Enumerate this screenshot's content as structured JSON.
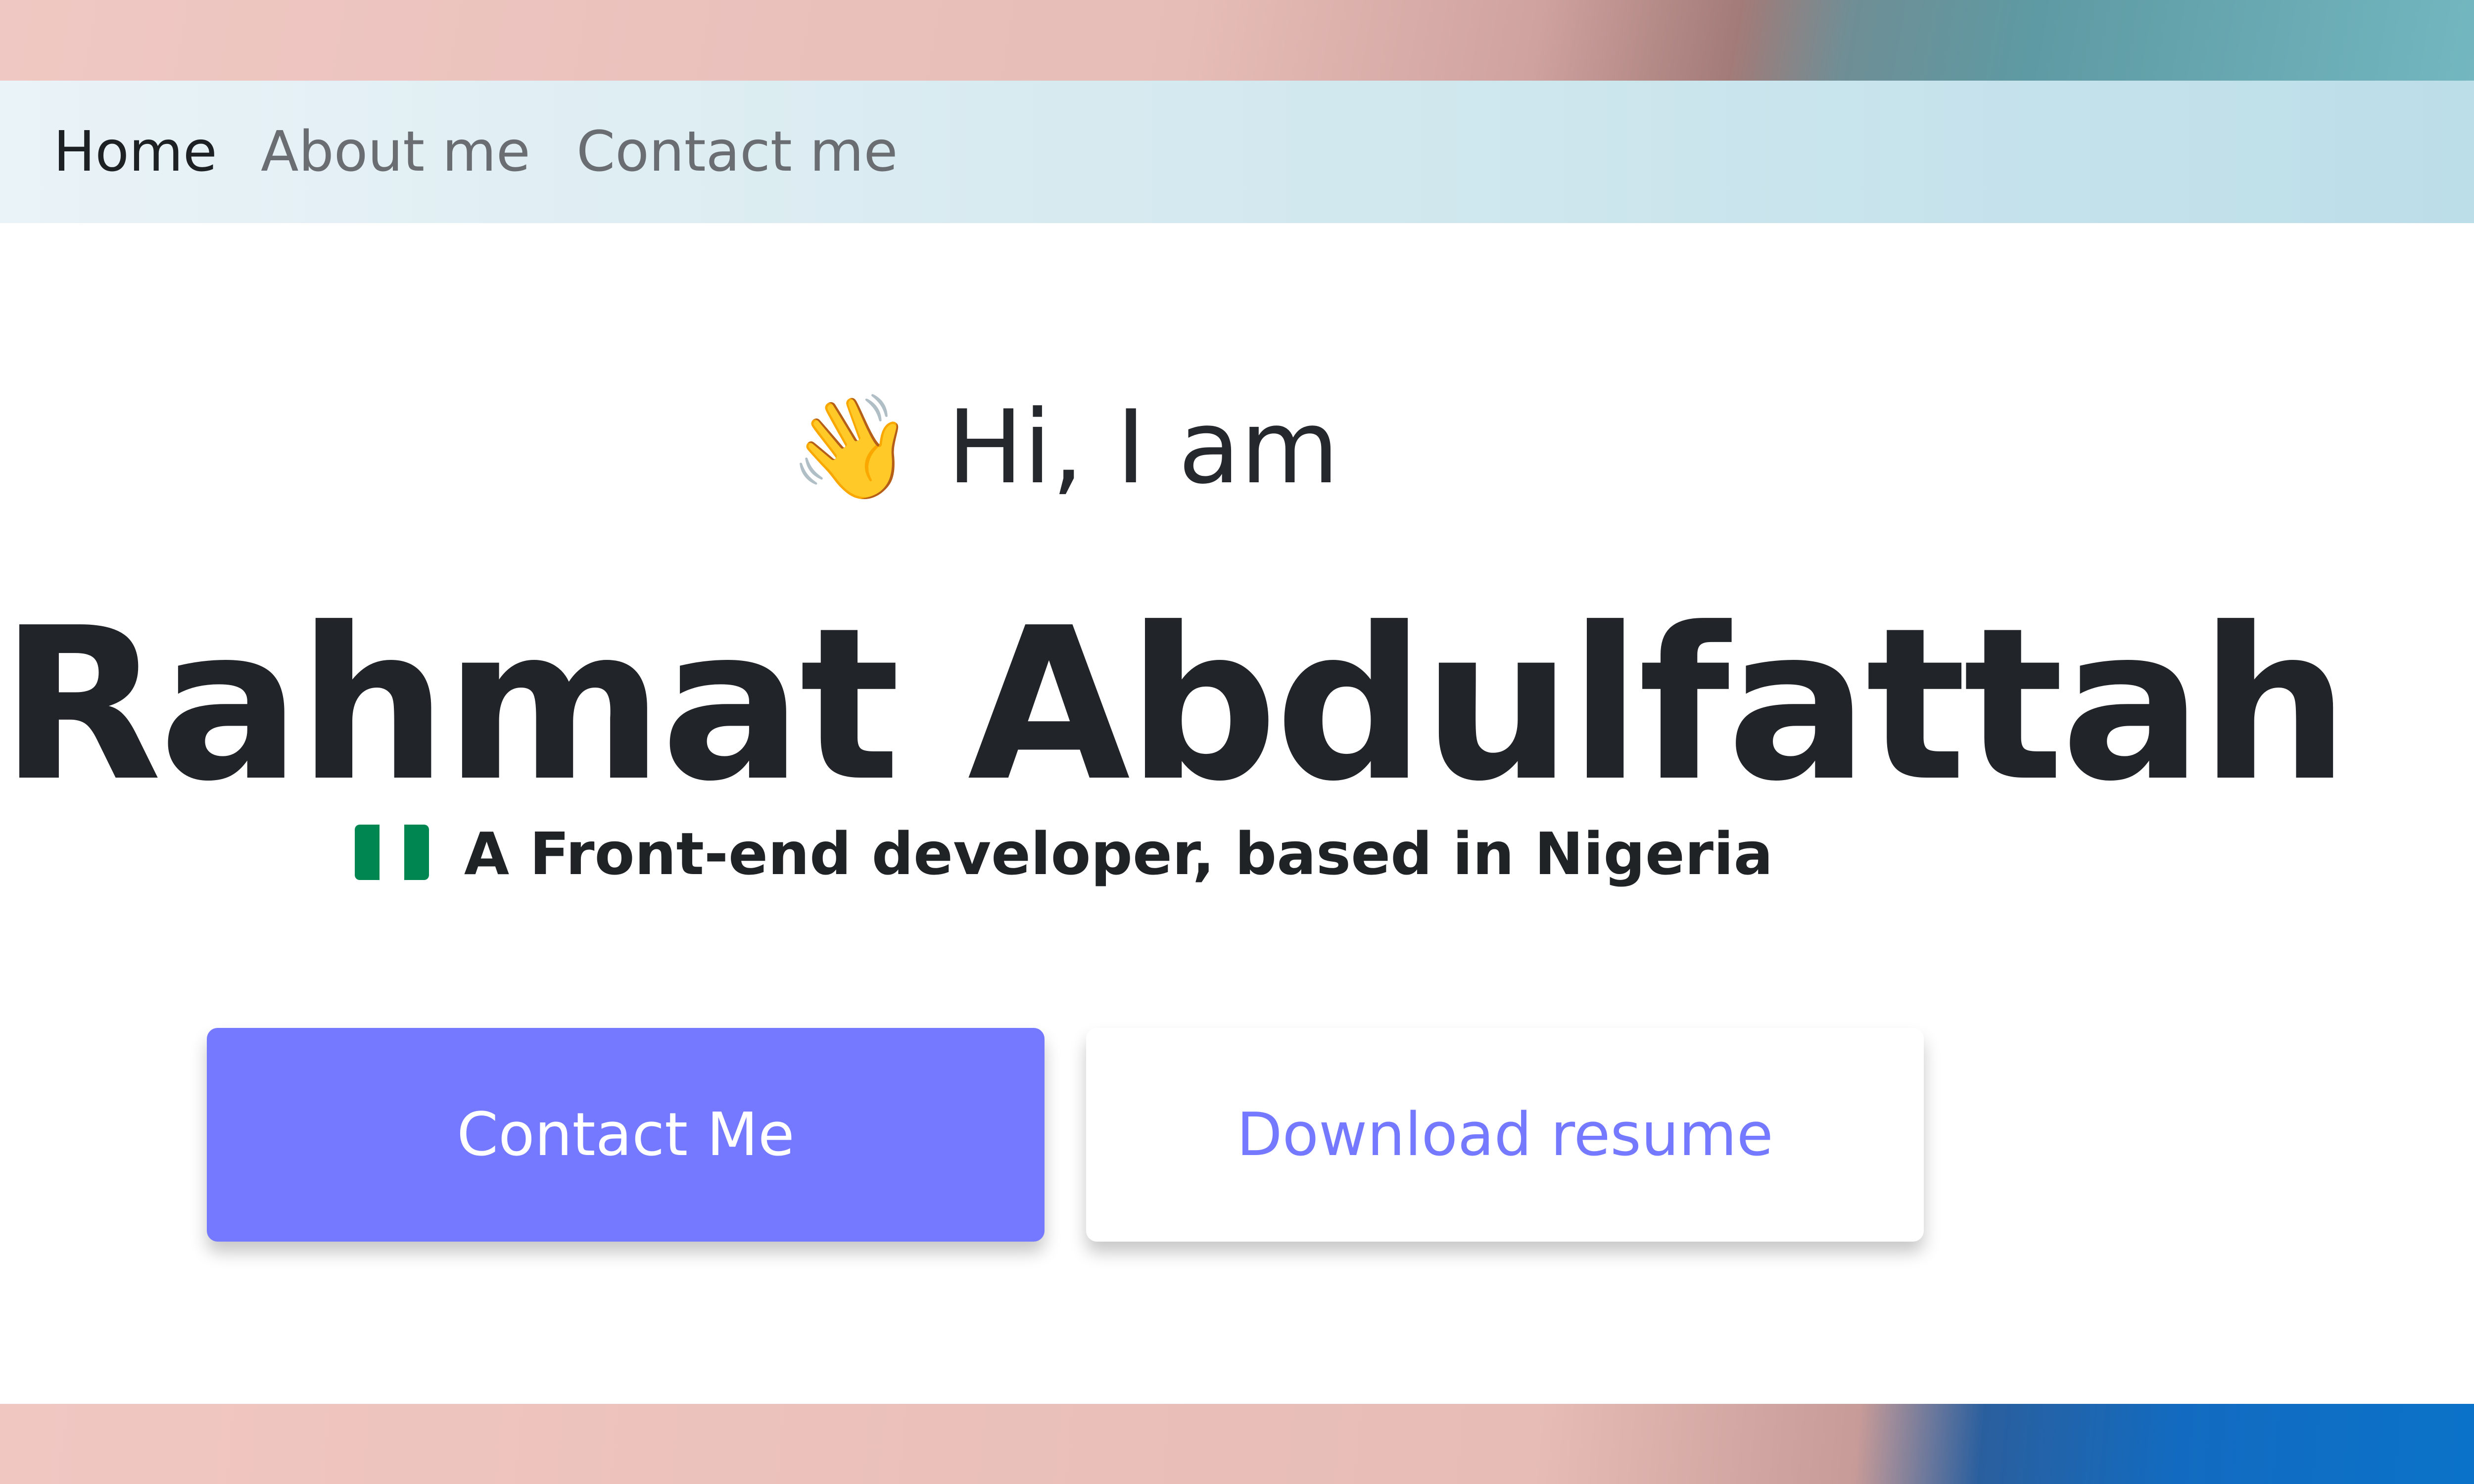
{
  "nav": {
    "items": [
      {
        "label": "Home",
        "active": true
      },
      {
        "label": "About me",
        "active": false
      },
      {
        "label": "Contact me",
        "active": false
      }
    ]
  },
  "hero": {
    "greeting_icon": "waving-hand-icon",
    "greeting_emoji": "👋",
    "greeting": "Hi, I am",
    "name": "Rahmat Abdulfattah",
    "tagline_icon": "nigeria-flag-icon",
    "tagline": "A Front-end developer, based in Nigeria"
  },
  "buttons": {
    "contact": "Contact Me",
    "resume": "Download resume"
  },
  "colors": {
    "accent": "#7579ff",
    "text": "#212529",
    "nav_inactive": "#6a6e72",
    "flag_green": "#008751",
    "flag_white": "#ffffff"
  }
}
